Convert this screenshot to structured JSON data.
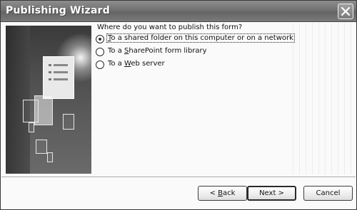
{
  "window": {
    "title": "Publishing Wizard"
  },
  "prompt": {
    "question": "Where do you want to publish this form?"
  },
  "options": [
    {
      "pre": "",
      "accel": "T",
      "post": "o a shared folder on this computer or on a network",
      "selected": true
    },
    {
      "pre": "To a ",
      "accel": "S",
      "post": "harePoint form library",
      "selected": false
    },
    {
      "pre": "To a ",
      "accel": "W",
      "post": "eb server",
      "selected": false
    }
  ],
  "buttons": {
    "back": {
      "label": "< Back",
      "accel_index": 2
    },
    "next": "Next >",
    "cancel": "Cancel"
  },
  "icons": {
    "close": "close-x-icon",
    "radio": "radio-button"
  }
}
